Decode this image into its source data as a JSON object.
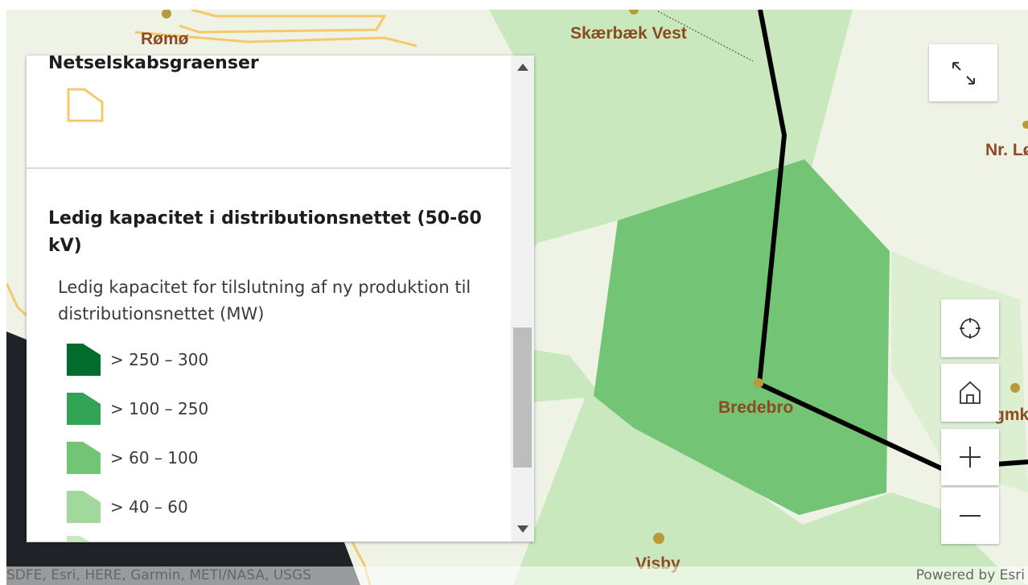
{
  "map": {
    "places": [
      {
        "name": "Rømø"
      },
      {
        "name": "Skærbæk Vest"
      },
      {
        "name": "Nr. Lø"
      },
      {
        "name": "Bredebro"
      },
      {
        "name": "Visby"
      },
      {
        "name": "gmkl"
      }
    ],
    "colors": {
      "background": "#eef3e6",
      "light_green": "#c9e8bd",
      "mid_green": "#74c476",
      "sea": "#1f2226",
      "boundary": "#f5c96b",
      "line": "#000000",
      "label": "#8c4a1e",
      "dot": "#b79a3c"
    }
  },
  "legend": {
    "layers": [
      {
        "title": "Netselskabsgraenser",
        "symbol": {
          "type": "polygon-outline",
          "color": "#f5c96b"
        }
      },
      {
        "title": "Ledig kapacitet i distributionsnettet (50-60 kV)",
        "description": "Ledig kapacitet for tilslutning af ny produktion til distributionsnettet (MW)",
        "items": [
          {
            "label": "> 250 – 300",
            "color": "#006d2c"
          },
          {
            "label": "> 100 – 250",
            "color": "#31a354"
          },
          {
            "label": "> 60 – 100",
            "color": "#74c476"
          },
          {
            "label": "> 40 – 60",
            "color": "#a1d99b"
          }
        ]
      }
    ],
    "scroll_position": 0.56
  },
  "controls": {
    "expand_icon": "expand-icon",
    "locate_icon": "locate-icon",
    "home_icon": "home-icon",
    "zoom_in_icon": "plus-icon",
    "zoom_out_icon": "minus-icon"
  },
  "attribution": {
    "sources": "SDFE, Esri, HERE, Garmin, METI/NASA, USGS",
    "powered_by": "Powered by Esri"
  }
}
